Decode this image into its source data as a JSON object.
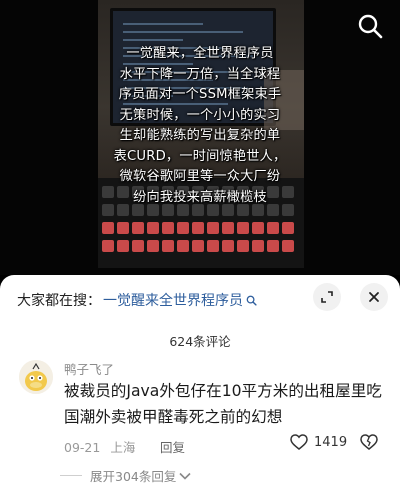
{
  "video": {
    "caption": "一觉醒来，全世界程序员\n水平下降一万倍，当全球程\n序员面对一个SSM框架束手\n无策时候，一个小小的实习\n生却能熟练的写出复杂的单\n表CURD，一时间惊艳世人，\n微软谷歌阿里等一众大厂纷\n纷向我投来高薪橄榄枝"
  },
  "search_bar": {
    "prefix": "大家都在搜：",
    "query": "一觉醒来全世界程序员",
    "query_icon": "search-icon"
  },
  "comments": {
    "count_label": "624条评论",
    "items": [
      {
        "username": "鸭子飞了",
        "text": "被裁员的Java外包仔在10平方米的出租屋里吃\n国潮外卖被甲醛毒死之前的幻想",
        "date": "09-21",
        "location": "上海",
        "reply_label": "回复",
        "likes": "1419",
        "expand_label": "展开304条回复"
      }
    ]
  },
  "colors": {
    "link": "#2e5e9d",
    "sheet_bg": "#ffffff",
    "muted": "#999999"
  }
}
